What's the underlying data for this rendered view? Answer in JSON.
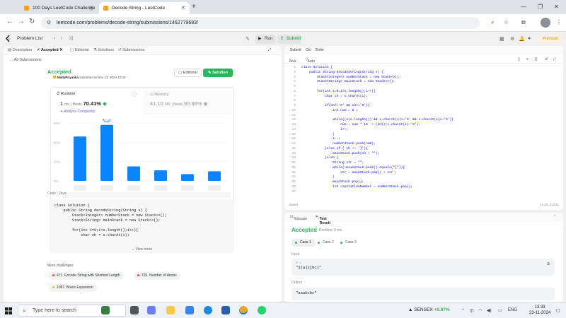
{
  "browser": {
    "tabs": [
      {
        "title": "100 Days LeetCode Challenge",
        "active": false
      },
      {
        "title": "Decode String - LeetCode",
        "active": true
      }
    ],
    "url": "leetcode.com/problems/decode-string/submissions/1462779683/"
  },
  "topbar": {
    "problem_list": "Problem List",
    "run": "Run",
    "submit": "Submit",
    "premium": "Premium"
  },
  "left_tabs": {
    "description": "Description",
    "accepted": "Accepted",
    "editorial": "Editorial",
    "solutions": "Solutions",
    "submissions": "Submissions"
  },
  "submission": {
    "all_submissions": "All Submissions",
    "status": "Accepted",
    "author": "MallyPriyanka",
    "submitted_text": "submitted at Nov 23, 2024 13:33",
    "editorial_btn": "Editorial",
    "solution_btn": "Solution",
    "runtime_label": "Runtime",
    "runtime_value": "1",
    "runtime_unit": "ms",
    "beats_label": "Beats",
    "runtime_beats": "70.41%",
    "analyze": "Analyze Complexity",
    "memory_label": "Memory",
    "memory_value": "41.10",
    "memory_unit": "MB",
    "memory_beats": "95.96%"
  },
  "chart_data": {
    "type": "bar",
    "categories": [
      "",
      "",
      "",
      "",
      "",
      ""
    ],
    "values": [
      46,
      58,
      15,
      11,
      7,
      10
    ],
    "highlight_index": 1,
    "yticks": [
      "60%",
      "40%",
      "20%",
      "0%"
    ],
    "ylim": [
      0,
      60
    ],
    "grid": true
  },
  "code_preview": {
    "header_code": "Code",
    "header_lang": "Java",
    "lines": [
      "class Solution {",
      "    public String decodeString(String s) {",
      "        Stack<Integer> numberStack = new Stack<>();",
      "        Stack<String> mainStack = new Stack<>();",
      "",
      "        for(int i=0;i<s.length();i++){",
      "            char ch = s.charAt(i);"
    ],
    "view_more": "View more"
  },
  "more_challenges": {
    "label": "More challenges",
    "items": [
      {
        "text": "471. Encode String with Shortest Length",
        "color": "#ef4743"
      },
      {
        "text": "726. Number of Atoms",
        "color": "#ef4743"
      },
      {
        "text": "1087. Brace Expansion",
        "color": "#ffb800"
      }
    ]
  },
  "editor": {
    "tabs": [
      "Submit",
      "Ctrl",
      "Enter"
    ],
    "language": "Java",
    "autosave": "Auto",
    "line_numbers": [
      "1",
      "2",
      "3",
      "4",
      "5",
      "6",
      "7",
      "8",
      "9",
      "10",
      "11",
      "12",
      "13",
      "14",
      "15",
      "16",
      "17",
      "18",
      "19",
      "20",
      "21",
      "22",
      "23",
      "24",
      "25",
      "26",
      "27"
    ],
    "lines": [
      "class Solution {",
      "    public String decodeString(String s) {",
      "        Stack<Integer> numberStack = new Stack<>();",
      "        Stack<String> mainStack = new Stack<>();",
      "",
      "        for(int i=0;i<s.length();i++){",
      "            char ch = s.charAt(i);",
      "",
      "            if(ch>='0' && ch<='9'){",
      "                int num = 0 ;",
      "",
      "                while((i<s.length()) && s.charAt(i)>='0' && s.charAt(i)<='9'){",
      "                    num = num * 10  + (int)(s.charAt(i)-'0');",
      "                    i++;",
      "                }",
      "                i--;",
      "                numberStack.push(num);",
      "            }else if ( ch != ']'){",
      "                mainStack.push(ch + \"\");",
      "            }else {",
      "                String str = \"\";",
      "                while(!mainStack.peek().equals(\"[\")){",
      "                    str = mainStack.pop() + str ;",
      "                }",
      "                mainStack.pop();",
      "                int repetitionNumber = numberStack.pop();",
      ""
    ],
    "saved": "Saved",
    "cursor": "Ln 20, Col 21"
  },
  "testresult": {
    "tab_testcase": "Testcase",
    "tab_result": "Test Result",
    "status": "Accepted",
    "runtime": "Runtime: 0 ms",
    "cases": [
      "Case 1",
      "Case 2",
      "Case 3"
    ],
    "input_label": "Input",
    "input_key": "s =",
    "input_value": "\"3[a]2[bc]\"",
    "output_label": "Output",
    "output_value": "\"aaabcbc\""
  },
  "taskbar": {
    "search_placeholder": "Type here to search",
    "sensex_label": "SENSEX",
    "sensex_change": "+0.87%",
    "lang": "ENG",
    "time": "13:33",
    "date": "23-11-2024"
  }
}
